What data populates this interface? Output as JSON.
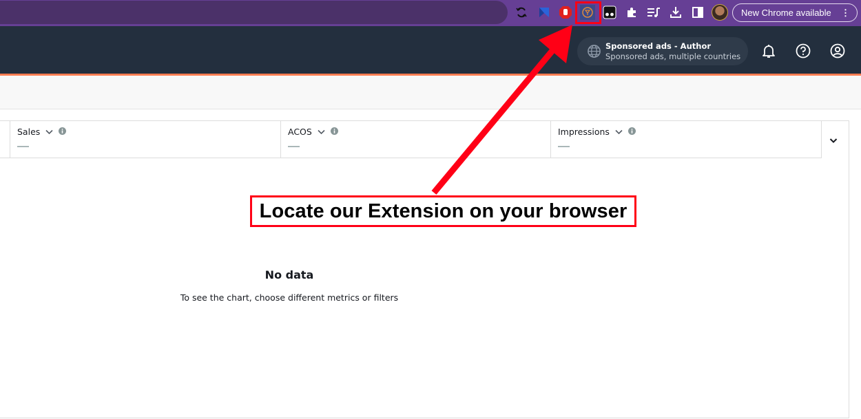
{
  "browser": {
    "extensions": [
      {
        "name": "sync-icon"
      },
      {
        "name": "bookmark-extension-icon"
      },
      {
        "name": "adblock-hand-icon"
      },
      {
        "name": "author-extension-icon",
        "highlighted": true
      },
      {
        "name": "tampermonkey-icon"
      },
      {
        "name": "puzzle-extensions-icon"
      },
      {
        "name": "media-controls-icon"
      },
      {
        "name": "download-icon"
      },
      {
        "name": "side-panel-icon"
      }
    ],
    "update_label": "New Chrome available",
    "menu_glyph": "⋮"
  },
  "header": {
    "account_title": "Sponsored ads - Author",
    "account_subtitle": "Sponsored ads, multiple countries",
    "icons": [
      "bell-icon",
      "help-icon",
      "profile-icon"
    ]
  },
  "metrics": [
    {
      "label": "Sales",
      "value": "—"
    },
    {
      "label": "ACOS",
      "value": "—"
    },
    {
      "label": "Impressions",
      "value": "—"
    }
  ],
  "chart": {
    "empty_title": "No data",
    "empty_message": "To see the chart, choose different metrics or filters"
  },
  "annotation": {
    "text": "Locate our Extension on your browser",
    "color": "#ff0016"
  },
  "colors": {
    "browser_bar": "#663f95",
    "app_header": "#232f3e",
    "accent": "#ff7d52"
  }
}
